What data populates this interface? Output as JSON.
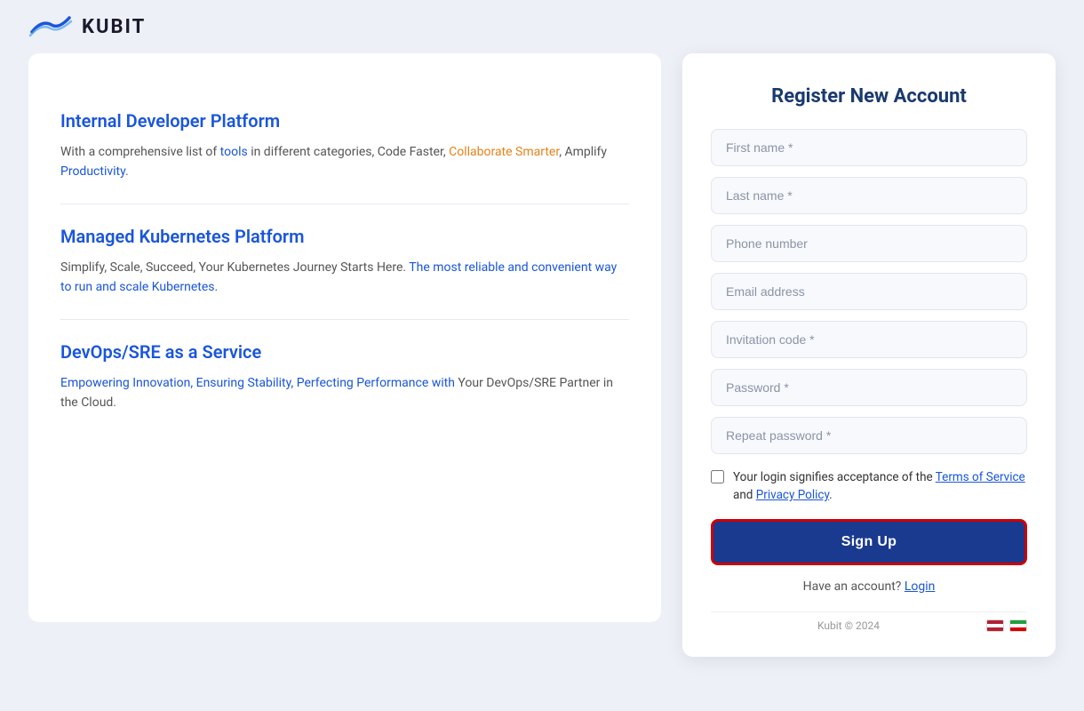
{
  "header": {
    "logo_text": "KUBIT"
  },
  "left_panel": {
    "sections": [
      {
        "title": "Internal Developer Platform",
        "description_parts": [
          {
            "text": "With a comprehensive list of ",
            "style": "normal"
          },
          {
            "text": "tools",
            "style": "blue"
          },
          {
            "text": " in different categories, Code Faster, ",
            "style": "normal"
          },
          {
            "text": "Collaborate Smarter",
            "style": "orange"
          },
          {
            "text": ", Amplify ",
            "style": "normal"
          },
          {
            "text": "Productivity",
            "style": "blue"
          },
          {
            "text": ".",
            "style": "normal"
          }
        ]
      },
      {
        "title": "Managed Kubernetes Platform",
        "description_parts": [
          {
            "text": "Simplify, Scale, Succeed, Your Kubernetes Journey Starts Here. ",
            "style": "normal"
          },
          {
            "text": "The most reliable and convenient way to run and scale Kubernetes.",
            "style": "blue"
          }
        ]
      },
      {
        "title": "DevOps/SRE as a Service",
        "description_parts": [
          {
            "text": "Empowering Innovation, Ensuring Stability, Perfecting Performance with ",
            "style": "blue"
          },
          {
            "text": "Your DevOps/SRE Partner in the Cloud.",
            "style": "normal"
          }
        ]
      }
    ]
  },
  "register_form": {
    "title": "Register New Account",
    "fields": [
      {
        "id": "first_name",
        "placeholder": "First name *",
        "type": "text"
      },
      {
        "id": "last_name",
        "placeholder": "Last name *",
        "type": "text"
      },
      {
        "id": "phone",
        "placeholder": "Phone number",
        "type": "tel"
      },
      {
        "id": "email",
        "placeholder": "Email address",
        "type": "email"
      },
      {
        "id": "invitation",
        "placeholder": "Invitation code *",
        "type": "text"
      },
      {
        "id": "password",
        "placeholder": "Password *",
        "type": "password"
      },
      {
        "id": "repeat_password",
        "placeholder": "Repeat password *",
        "type": "password"
      }
    ],
    "terms_text_before": "Your login signifies acceptance of the ",
    "terms_of_service_label": "Terms of Service",
    "terms_and": " and ",
    "privacy_policy_label": "Privacy Policy",
    "terms_text_after": ".",
    "signup_button_label": "Sign Up",
    "have_account_text": "Have an account?",
    "login_link_label": "Login",
    "footer_copy": "Kubit © 2024"
  }
}
